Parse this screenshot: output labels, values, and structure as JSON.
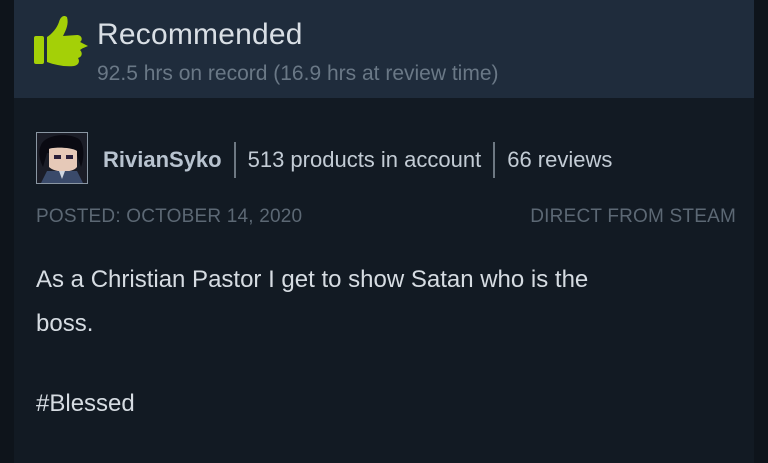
{
  "review": {
    "verdict": "Recommended",
    "hours": "92.5 hrs on record (16.9 hrs at review time)",
    "thumb_icon": "thumbs-up-icon",
    "colors": {
      "thumb": "#a4d007",
      "header_bg": "#1f2c3c",
      "card_bg": "#121a23"
    }
  },
  "author": {
    "avatar_icon": "avatar-icon",
    "username": "RivianSyko",
    "products": "513 products in account",
    "reviews": "66 reviews"
  },
  "meta": {
    "posted": "POSTED: OCTOBER 14, 2020",
    "source": "DIRECT FROM STEAM"
  },
  "content": {
    "line1": "As a Christian Pastor I get to show Satan who is the",
    "line2": "boss.",
    "hashtag": "#Blessed"
  }
}
